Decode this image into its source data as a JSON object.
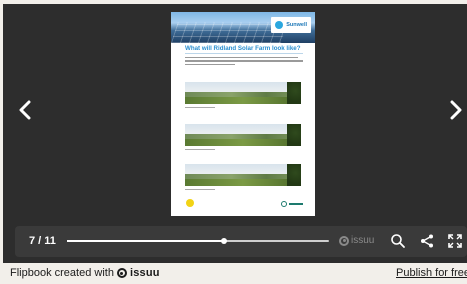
{
  "viewer": {
    "prev_label": "Previous page",
    "next_label": "Next page"
  },
  "document": {
    "title": "What will Ridland Solar Farm look like?",
    "logo_text": "Sunwell",
    "footer_badge": "",
    "footer_logo": ""
  },
  "toolbar": {
    "page_counter": "7 / 11",
    "progress": 0.6,
    "brand": "issuu",
    "icons": [
      "search-icon",
      "share-icon",
      "fullscreen-icon"
    ]
  },
  "bottom_bar": {
    "credit_prefix": "Flipbook created with",
    "credit_brand": "issuu",
    "publish_link": "Publish for free"
  },
  "colors": {
    "viewer_bg": "#2d2d2d",
    "toolbar_bg": "#3a3a3a",
    "page_title": "#2a8ecf",
    "bottom_bg": "#f2efea"
  }
}
